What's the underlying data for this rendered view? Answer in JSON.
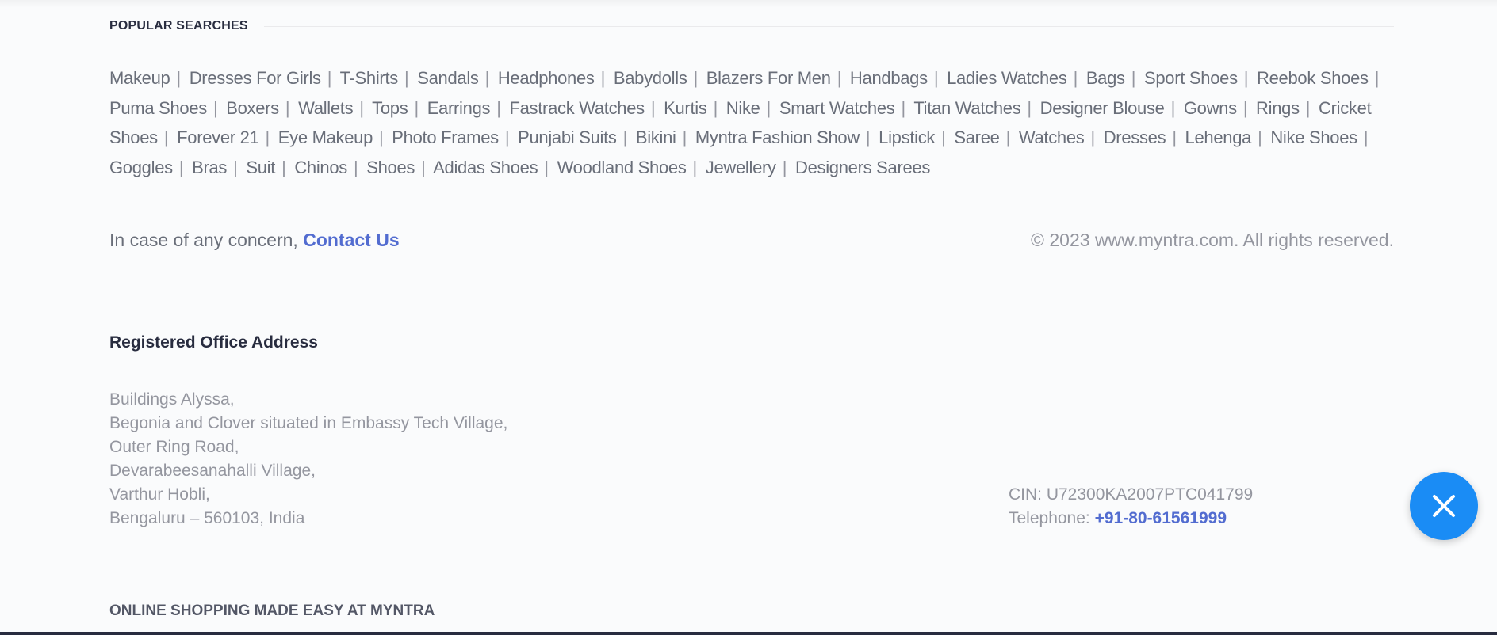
{
  "popular_searches": {
    "title": "POPULAR SEARCHES",
    "separator": "|",
    "links": [
      "Makeup",
      "Dresses For Girls",
      "T-Shirts",
      "Sandals",
      "Headphones",
      "Babydolls",
      "Blazers For Men",
      "Handbags",
      "Ladies Watches",
      "Bags",
      "Sport Shoes",
      "Reebok Shoes",
      "Puma Shoes",
      "Boxers",
      "Wallets",
      "Tops",
      "Earrings",
      "Fastrack Watches",
      "Kurtis",
      "Nike",
      "Smart Watches",
      "Titan Watches",
      "Designer Blouse",
      "Gowns",
      "Rings",
      "Cricket Shoes",
      "Forever 21",
      "Eye Makeup",
      "Photo Frames",
      "Punjabi Suits",
      "Bikini",
      "Myntra Fashion Show",
      "Lipstick",
      "Saree",
      "Watches",
      "Dresses",
      "Lehenga",
      "Nike Shoes",
      "Goggles",
      "Bras",
      "Suit",
      "Chinos",
      "Shoes",
      "Adidas Shoes",
      "Woodland Shoes",
      "Jewellery",
      "Designers Sarees"
    ]
  },
  "concern": {
    "text": "In case of any concern, ",
    "link": "Contact Us",
    "copyright": "© 2023 www.myntra.com. All rights reserved."
  },
  "registered_office": {
    "title": "Registered Office Address",
    "address_lines": [
      "Buildings Alyssa,",
      "Begonia and Clover situated in Embassy Tech Village,",
      "Outer Ring Road,",
      "Devarabeesanahalli Village,",
      "Varthur Hobli,",
      "Bengaluru – 560103, India"
    ],
    "cin": "CIN: U72300KA2007PTC041799",
    "telephone_label": "Telephone: ",
    "telephone_number": "+91-80-61561999"
  },
  "online_shopping": {
    "title": "ONLINE SHOPPING MADE EASY AT MYNTRA"
  },
  "fab": {
    "icon": "close-icon",
    "color": "#1a8cf5"
  },
  "colors": {
    "link_accent": "#526cd0",
    "heading": "#282c3f",
    "body_text": "#696e79",
    "muted_text": "#94969f"
  }
}
